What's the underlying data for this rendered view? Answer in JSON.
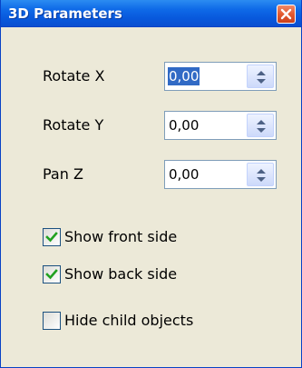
{
  "window": {
    "title": "3D Parameters"
  },
  "fields": [
    {
      "label": "Rotate X",
      "value": "0,00",
      "selected": true
    },
    {
      "label": "Rotate Y",
      "value": "0,00",
      "selected": false
    },
    {
      "label": "Pan Z",
      "value": "0,00",
      "selected": false
    }
  ],
  "checkboxes": [
    {
      "label": "Show front side",
      "checked": true
    },
    {
      "label": "Show back side",
      "checked": true
    },
    {
      "label": "Hide child objects",
      "checked": false
    }
  ],
  "icons": {
    "close": "close-icon",
    "spin_up": "spin-up-arrow-icon",
    "spin_down": "spin-down-arrow-icon",
    "check": "checkmark-icon"
  },
  "colors": {
    "titlebar": "#0858dc",
    "close_button": "#e35a30",
    "selection": "#316ac5",
    "checkmark": "#21a121",
    "window_bg": "#ece9d8"
  }
}
